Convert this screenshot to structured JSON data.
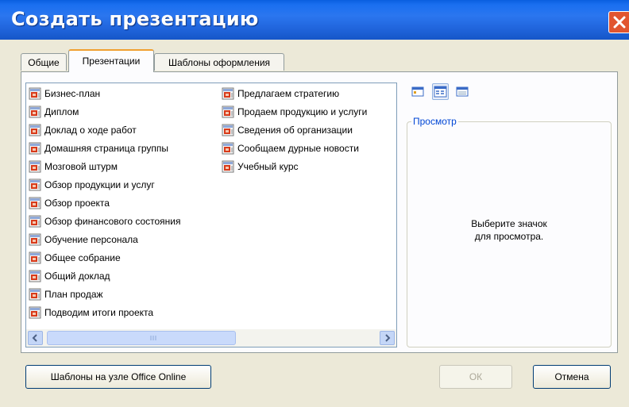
{
  "dialog": {
    "title": "Создать презентацию"
  },
  "tabs": [
    {
      "label": "Общие",
      "active": false
    },
    {
      "label": "Презентации",
      "active": true
    },
    {
      "label": "Шаблоны оформления",
      "active": false
    }
  ],
  "templates": {
    "column1": [
      "Бизнес-план",
      "Диплом",
      "Доклад о ходе работ",
      "Домашняя страница группы",
      "Мозговой штурм",
      "Обзор продукции и услуг",
      "Обзор проекта",
      "Обзор финансового состояния",
      "Обучение персонала",
      "Общее собрание",
      "Общий доклад",
      "План продаж",
      "Подводим итоги проекта"
    ],
    "column2": [
      "Предлагаем стратегию",
      "Продаем продукцию и услуги",
      "Сведения об организации",
      "Сообщаем дурные новости",
      "Учебный курс"
    ],
    "item_icon": "powerpoint-template-icon"
  },
  "view_buttons": [
    {
      "icon": "large-icons-view-icon",
      "selected": false
    },
    {
      "icon": "list-view-icon",
      "selected": true
    },
    {
      "icon": "details-view-icon",
      "selected": false
    }
  ],
  "preview": {
    "label": "Просмотр",
    "hint_line1": "Выберите значок",
    "hint_line2": "для просмотра."
  },
  "buttons": {
    "office_online": "Шаблоны на узле Office Online",
    "ok": "ОК",
    "ok_enabled": false,
    "cancel": "Отмена"
  },
  "colors": {
    "titlebar": "#2b76ef",
    "close": "#e1552f",
    "dialog_bg": "#ece9d8",
    "active_tab_accent": "#f0a030",
    "preview_label": "#0046d5"
  }
}
